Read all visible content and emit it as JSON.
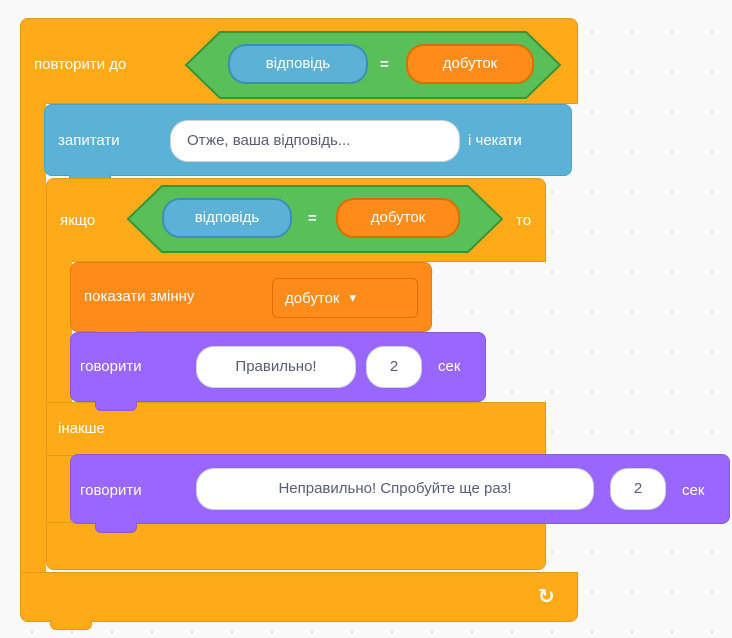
{
  "repeat_until": {
    "label": "повторити до",
    "condition": {
      "left": "відповідь",
      "op": "=",
      "right": "добуток"
    }
  },
  "ask": {
    "label": "запитати",
    "question": "Отже, ваша відповідь...",
    "suffix": "і чекати"
  },
  "if_block": {
    "label": "якщо",
    "condition": {
      "left": "відповідь",
      "op": "=",
      "right": "добуток"
    },
    "then_label": "то",
    "else_label": "інакше"
  },
  "show_variable": {
    "label": "показати змінну",
    "variable": "добуток"
  },
  "say_correct": {
    "label": "говорити",
    "message": "Правильно!",
    "seconds": "2",
    "unit": "сек"
  },
  "say_wrong": {
    "label": "говорити",
    "message": "Неправильно! Спробуйте ще раз!",
    "seconds": "2",
    "unit": "сек"
  },
  "icons": {
    "loop_arrow": "↻",
    "dropdown_caret": "▾"
  },
  "colors": {
    "control": "#ffab19",
    "sensing": "#5cb1d6",
    "operators": "#59c059",
    "variables": "#ff8c1a",
    "looks": "#9966ff"
  }
}
